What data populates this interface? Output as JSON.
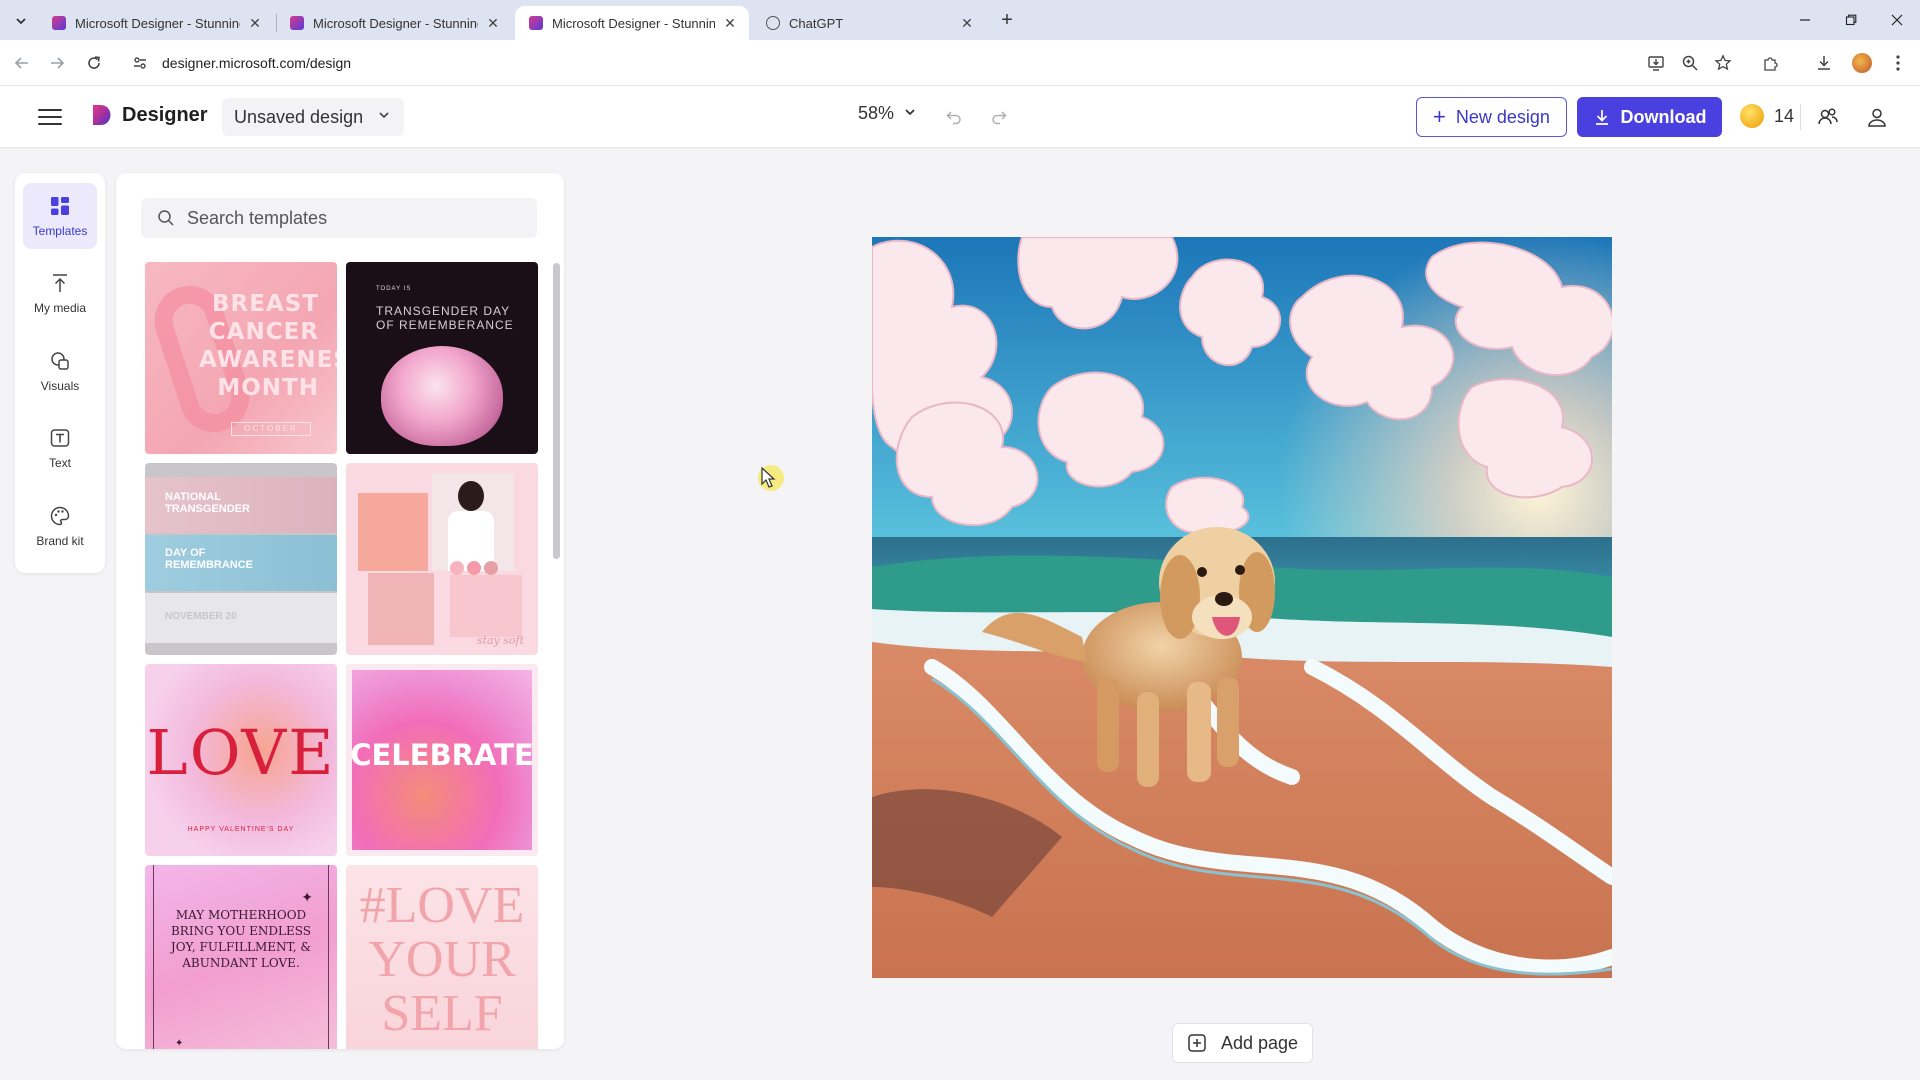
{
  "browser": {
    "tabs": [
      {
        "title": "Microsoft Designer - Stunning",
        "active": false
      },
      {
        "title": "Microsoft Designer - Stunning",
        "active": false
      },
      {
        "title": "Microsoft Designer - Stunning",
        "active": true
      },
      {
        "title": "ChatGPT",
        "active": false
      }
    ],
    "url": "designer.microsoft.com/design"
  },
  "header": {
    "brand": "Designer",
    "design_name": "Unsaved design",
    "zoom": "58%",
    "new_design_label": "New design",
    "download_label": "Download",
    "credits": "14"
  },
  "rail": {
    "items": [
      {
        "label": "Templates",
        "icon": "templates-icon",
        "active": true
      },
      {
        "label": "My media",
        "icon": "upload-icon",
        "active": false
      },
      {
        "label": "Visuals",
        "icon": "shapes-icon",
        "active": false
      },
      {
        "label": "Text",
        "icon": "text-icon",
        "active": false
      },
      {
        "label": "Brand kit",
        "icon": "palette-icon",
        "active": false
      }
    ]
  },
  "panel": {
    "search_placeholder": "Search templates",
    "templates": [
      {
        "name": "breast-cancer-awareness",
        "text": "BREAST CANCER AWARENESS MONTH",
        "tag": "OCTOBER"
      },
      {
        "name": "transgender-day-of-remembrance",
        "small": "TODAY IS",
        "text": "TRANSGENDER DAY OF REMEMBERANCE"
      },
      {
        "name": "national-transgender-day",
        "line1": "NATIONAL TRANSGENDER",
        "line2": "DAY OF REMEMBRANCE",
        "line3": "NOVEMBER 20"
      },
      {
        "name": "stay-soft-collage",
        "text": "stay soft"
      },
      {
        "name": "love-valentines",
        "text": "LOVE",
        "sub": "HAPPY VALENTINE'S DAY"
      },
      {
        "name": "celebrate",
        "text": "CELEBRATE"
      },
      {
        "name": "motherhood",
        "text": "MAY MOTHERHOOD BRING YOU ENDLESS JOY, FULFILLMENT, & ABUNDANT LOVE."
      },
      {
        "name": "love-yourself",
        "text": "#LOVE YOUR SELF"
      }
    ]
  },
  "canvas": {
    "add_page_label": "Add page"
  },
  "colors": {
    "accent": "#4a40e0",
    "accent_light": "#ece9fd",
    "tabstrip": "#dde3f1"
  }
}
